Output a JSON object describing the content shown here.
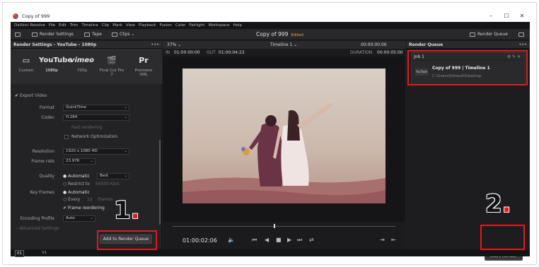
{
  "window": {
    "title": "Copy of 999",
    "min": "–",
    "max": "☐",
    "close": "✕"
  },
  "menu": [
    "DaVinci Resolve",
    "File",
    "Edit",
    "Trim",
    "Timeline",
    "Clip",
    "Mark",
    "View",
    "Playback",
    "Fusion",
    "Color",
    "Fairlight",
    "Workspace",
    "Help"
  ],
  "toolbar": {
    "render_settings": "Render Settings",
    "tape": "Tape",
    "clips": "Clips",
    "project": "Copy of 999",
    "edited": "Edited",
    "render_queue": "Render Queue"
  },
  "left": {
    "header": "Render Settings - YouTube - 1080p",
    "presets": [
      {
        "glyph": "▭",
        "label": "Custom"
      },
      {
        "glyph": "YouTube",
        "label": "1080p"
      },
      {
        "glyph": "vimeo",
        "label": "720p"
      },
      {
        "glyph": "🎬",
        "label": "Final Cut Pro 7"
      },
      {
        "glyph": "Pr",
        "label": "Premiere XML"
      }
    ],
    "export_video": "Export Video",
    "format_label": "Format",
    "format_value": "QuickTime",
    "codec_label": "Codec",
    "codec_value": "H.264",
    "fast_rendering": "Fast rendering",
    "network_opt": "Network Optimization",
    "resolution_label": "Resolution",
    "resolution_value": "1920 x 1080 HD",
    "framerate_label": "Frame rate",
    "framerate_value": "23.976",
    "quality_label": "Quality",
    "quality_auto": "Automatic",
    "quality_value": "Best",
    "restrict_to": "Restrict to",
    "restrict_val": "50000",
    "restrict_unit": "Kb/s",
    "keyframes_label": "Key Frames",
    "kf_auto": "Automatic",
    "kf_every": "Every",
    "kf_val": "12",
    "kf_unit": "frames",
    "frame_reordering": "Frame reordering",
    "encoding_label": "Encoding Profile",
    "encoding_value": "Auto",
    "advanced": "Advanced Settings",
    "add_queue": "Add to Render Queue"
  },
  "center": {
    "zoom": "37%",
    "timeline": "Timeline 1",
    "tc_top": "00:00:00:00",
    "in_label": "IN",
    "in_val": "01:00:00:00",
    "out_label": "OUT",
    "out_val": "01:00:04:23",
    "duration_label": "DURATION",
    "duration_val": "00:00:05:00",
    "timecode": "01:00:02:06"
  },
  "right": {
    "header": "Render Queue",
    "job": "Job 1",
    "job_title": "Copy of 999 | Timeline 1",
    "job_path": "C:\\Users\\Default\\Desktop",
    "thumb": "YouTube",
    "start_render": "Start Render"
  },
  "bottom": {
    "track1": "01",
    "track2": "V1"
  },
  "annotations": {
    "one": "1",
    "two": "2",
    "dot": "."
  }
}
